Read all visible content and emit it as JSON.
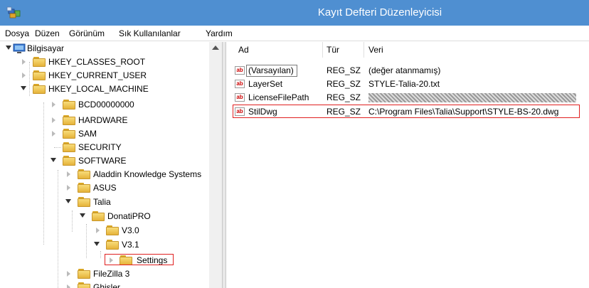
{
  "window": {
    "title": "Kayıt Defteri Düzenleyicisi",
    "icon": "registry-editor-icon"
  },
  "menu": [
    "Dosya",
    "Düzen",
    "Görünüm",
    "Sık Kullanılanlar",
    "Yardım"
  ],
  "tree": {
    "root": "Bilgisayar",
    "hkcr": "HKEY_CLASSES_ROOT",
    "hkcu": "HKEY_CURRENT_USER",
    "hklm": "HKEY_LOCAL_MACHINE",
    "bcd": "BCD00000000",
    "hardware": "HARDWARE",
    "sam": "SAM",
    "security": "SECURITY",
    "software": "SOFTWARE",
    "aladdin": "Aladdin Knowledge Systems",
    "asus": "ASUS",
    "talia": "Talia",
    "donatipro": "DonatiPRO",
    "v30": "V3.0",
    "v31": "V3.1",
    "settings": "Settings",
    "filezilla": "FileZilla 3",
    "ghisler": "Ghisler"
  },
  "columns": {
    "name": "Ad",
    "type": "Tür",
    "data": "Veri"
  },
  "values": [
    {
      "name": "(Varsayılan)",
      "type": "REG_SZ",
      "data": "(değer atanmamış)"
    },
    {
      "name": "LayerSet",
      "type": "REG_SZ",
      "data": "STYLE-Talia-20.txt"
    },
    {
      "name": "LicenseFilePath",
      "type": "REG_SZ",
      "data": ""
    },
    {
      "name": "StilDwg",
      "type": "REG_SZ",
      "data": "C:\\Program Files\\Talia\\Support\\STYLE-BS-20.dwg"
    }
  ],
  "colors": {
    "titlebar": "#4f8fd1",
    "highlight_border": "#e02020"
  }
}
